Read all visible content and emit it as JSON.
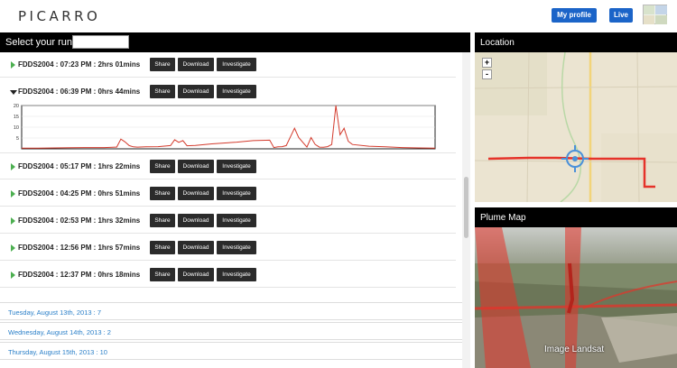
{
  "header": {
    "logo": "PICARRO",
    "my_profile": "My profile",
    "live": "Live"
  },
  "run_selector": {
    "label": "Select your run:",
    "value": ""
  },
  "buttons": {
    "share": "Share",
    "download": "Download",
    "investigate": "Investigate"
  },
  "runs": [
    {
      "label": "FDDS2004 : 07:23 PM : 2hrs 01mins",
      "expanded": false
    },
    {
      "label": "FDDS2004 : 06:39 PM : 0hrs 44mins",
      "expanded": true
    },
    {
      "label": "FDDS2004 : 05:17 PM : 1hrs 22mins",
      "expanded": false
    },
    {
      "label": "FDDS2004 : 04:25 PM : 0hrs 51mins",
      "expanded": false
    },
    {
      "label": "FDDS2004 : 02:53 PM : 1hrs 32mins",
      "expanded": false
    },
    {
      "label": "FDDS2004 : 12:56 PM : 1hrs 57mins",
      "expanded": false
    },
    {
      "label": "FDDS2004 : 12:37 PM : 0hrs 18mins",
      "expanded": false
    }
  ],
  "chart_data": {
    "type": "line",
    "title": "",
    "xlabel": "",
    "ylabel": "",
    "ylim": [
      0,
      20
    ],
    "yticks": [
      "20",
      "15",
      "10",
      "5"
    ],
    "grid": true,
    "color": "#d33a2c",
    "x": [
      0,
      4,
      8,
      12,
      15,
      20,
      23,
      24,
      25,
      26,
      27,
      28,
      30,
      33,
      36,
      37,
      38,
      39,
      40,
      42,
      46,
      52,
      56,
      60,
      61,
      62,
      63,
      64,
      65,
      66,
      67,
      69,
      70,
      71,
      72,
      73,
      74,
      75,
      76,
      77,
      78,
      79,
      80,
      84,
      88,
      92,
      96,
      100
    ],
    "y": [
      0.3,
      0.3,
      0.4,
      0.5,
      0.6,
      0.6,
      0.8,
      4.5,
      3.2,
      1.5,
      0.9,
      0.8,
      0.9,
      1.0,
      1.5,
      4.2,
      3.0,
      3.8,
      1.4,
      1.6,
      2.3,
      3.1,
      3.8,
      4.0,
      0.6,
      0.9,
      1.0,
      1.5,
      5.5,
      9.5,
      5.2,
      0.8,
      5.2,
      2.0,
      0.8,
      0.7,
      1.0,
      2.0,
      20.0,
      6.5,
      9.5,
      3.5,
      2.0,
      1.2,
      0.9,
      0.6,
      0.4,
      0.3
    ]
  },
  "dates": [
    "Tuesday, August 13th, 2013 : 7",
    "Wednesday, August 14th, 2013 : 2",
    "Thursday, August 15th, 2013 : 10"
  ],
  "location_panel": {
    "title": "Location",
    "zoom_in": "+",
    "zoom_out": "-"
  },
  "plume_panel": {
    "title": "Plume Map",
    "watermark": "Image Landsat"
  }
}
